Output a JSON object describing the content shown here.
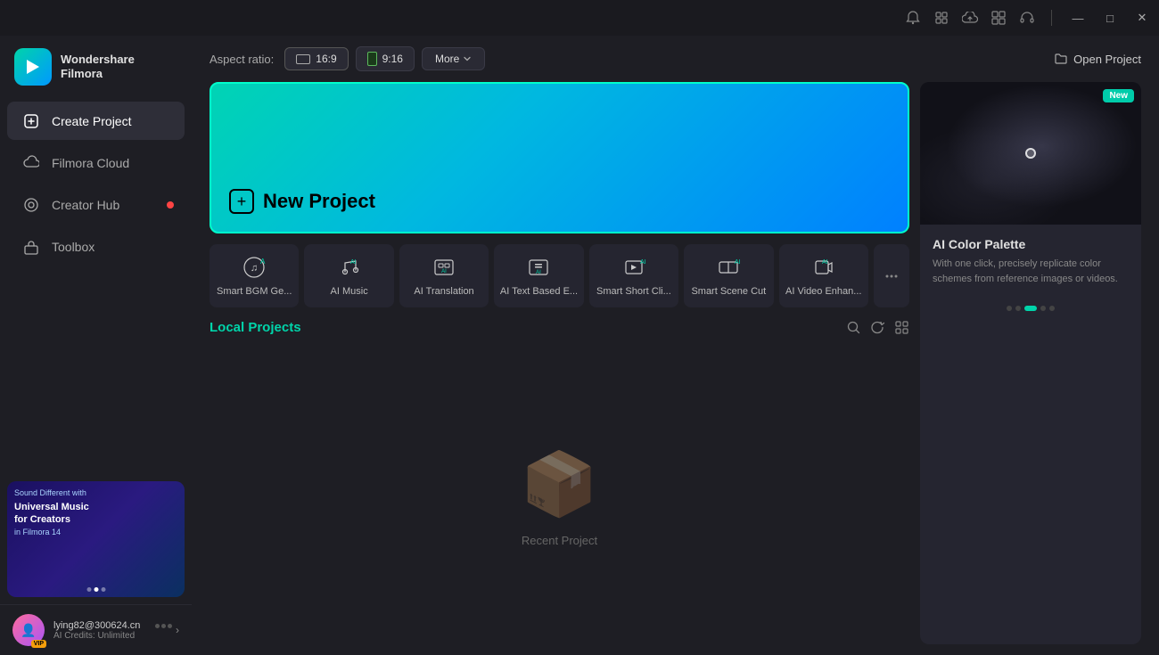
{
  "app": {
    "name": "Wondershare",
    "sub": "Filmora"
  },
  "titlebar": {
    "minimize": "—",
    "maximize": "□",
    "close": "✕"
  },
  "sidebar": {
    "items": [
      {
        "id": "create-project",
        "label": "Create Project",
        "active": true,
        "dot": false
      },
      {
        "id": "filmora-cloud",
        "label": "Filmora Cloud",
        "active": false,
        "dot": false
      },
      {
        "id": "creator-hub",
        "label": "Creator Hub",
        "active": false,
        "dot": true
      },
      {
        "id": "toolbox",
        "label": "Toolbox",
        "active": false,
        "dot": false
      }
    ],
    "promo": {
      "line1": "Sound Different with",
      "title": "Universal Music\nfor Creators",
      "line3": "in Filmora 14"
    },
    "user": {
      "email": "lying82@300624.cn",
      "credits": "AI Credits: Unlimited",
      "vip": "VIP"
    }
  },
  "topbar": {
    "aspect_label": "Aspect ratio:",
    "btn_16_9": "16:9",
    "btn_9_16": "9:16",
    "btn_more": "More",
    "btn_open": "Open Project"
  },
  "new_project": {
    "label": "New Project"
  },
  "ai_tools": [
    {
      "id": "smart-bgm",
      "label": "Smart BGM Ge...",
      "icon": "🎵"
    },
    {
      "id": "ai-music",
      "label": "AI Music",
      "icon": "🎶"
    },
    {
      "id": "ai-translation",
      "label": "AI Translation",
      "icon": "🔤"
    },
    {
      "id": "ai-text-based",
      "label": "AI Text Based E...",
      "icon": "📝"
    },
    {
      "id": "smart-short",
      "label": "Smart Short Cli...",
      "icon": "🎬"
    },
    {
      "id": "smart-scene-cut",
      "label": "Smart Scene Cut",
      "icon": "✂️"
    },
    {
      "id": "ai-video-enhance",
      "label": "AI Video Enhan...",
      "icon": "✨"
    }
  ],
  "local_projects": {
    "title": "Local Projects",
    "empty_label": "Recent Project"
  },
  "right_panel": {
    "badge": "New",
    "title": "AI Color Palette",
    "desc": "With one click, precisely replicate color schemes from reference images or videos.",
    "carousel_dots": 5,
    "active_dot": 2
  },
  "colors": {
    "accent_teal": "#00d4aa",
    "accent_blue": "#0080ff",
    "sidebar_bg": "#1e1e24",
    "card_bg": "#252530"
  }
}
